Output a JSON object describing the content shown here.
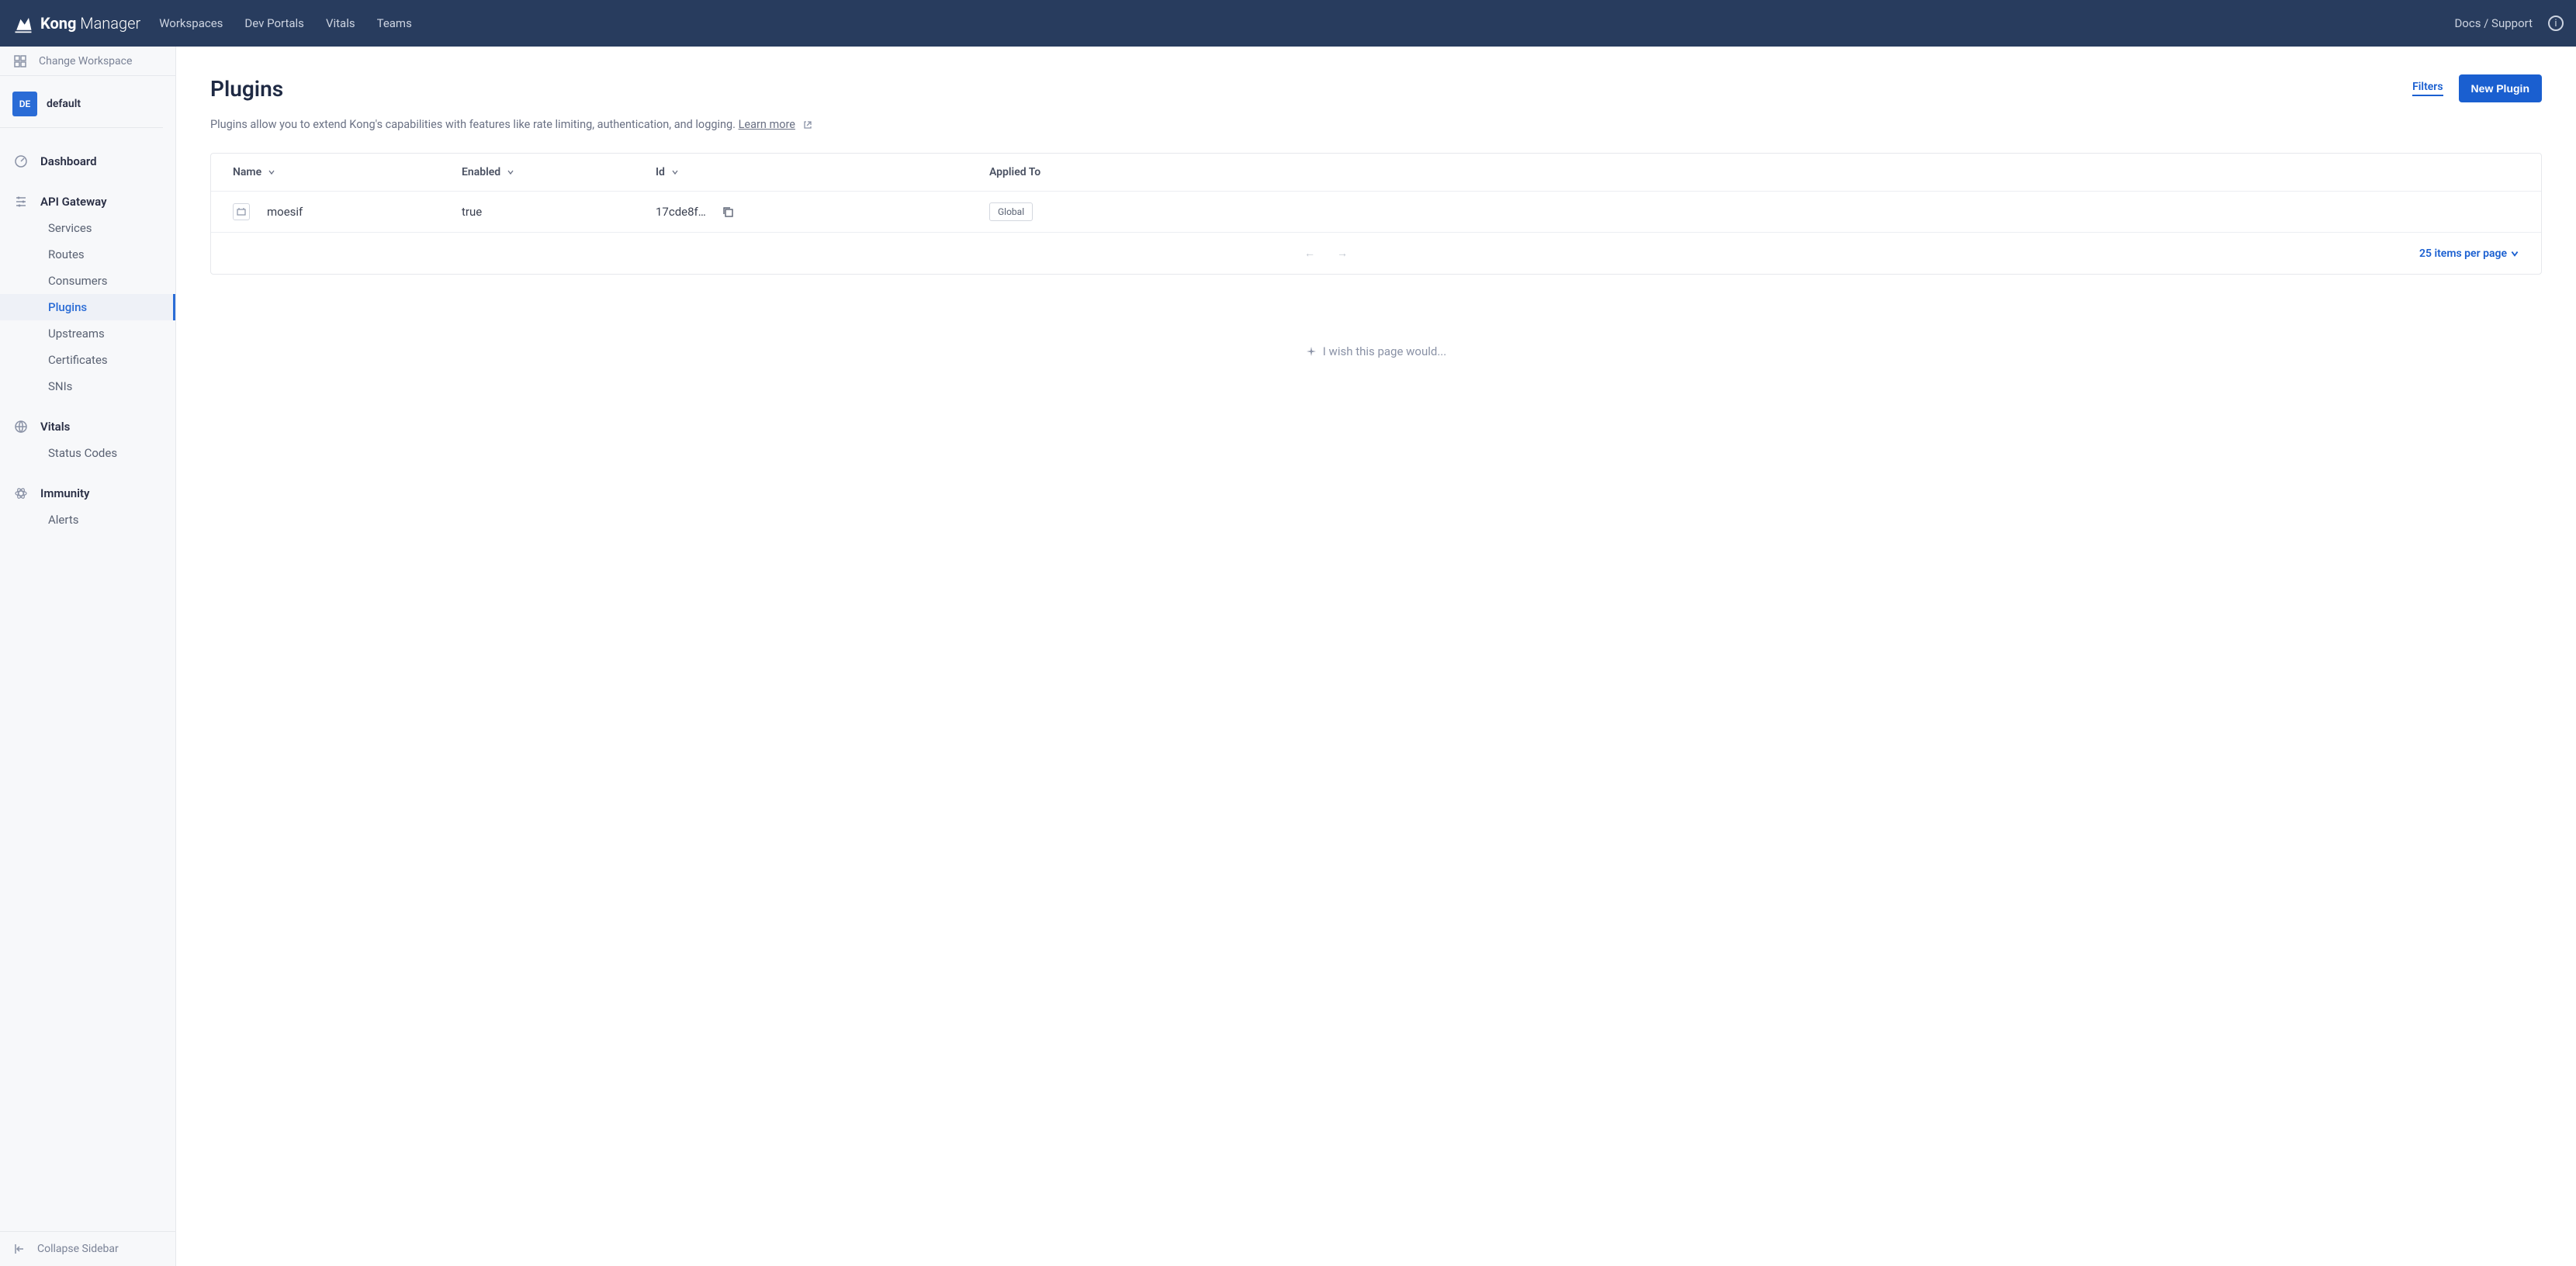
{
  "brand": {
    "name_bold": "Kong",
    "name_light": " Manager"
  },
  "topnav": [
    "Workspaces",
    "Dev Portals",
    "Vitals",
    "Teams"
  ],
  "top_right": {
    "docs": "Docs / Support"
  },
  "sidebar": {
    "change_workspace": "Change Workspace",
    "workspace_badge": "DE",
    "workspace_name": "default",
    "dashboard": "Dashboard",
    "api_gateway": {
      "label": "API Gateway",
      "items": [
        "Services",
        "Routes",
        "Consumers",
        "Plugins",
        "Upstreams",
        "Certificates",
        "SNIs"
      ],
      "active_index": 3
    },
    "vitals": {
      "label": "Vitals",
      "items": [
        "Status Codes"
      ]
    },
    "immunity": {
      "label": "Immunity",
      "items": [
        "Alerts"
      ]
    },
    "collapse": "Collapse Sidebar"
  },
  "page": {
    "title": "Plugins",
    "filters": "Filters",
    "new_button": "New Plugin",
    "description": "Plugins allow you to extend Kong's capabilities with features like rate limiting, authentication, and logging. ",
    "learn_more": "Learn more"
  },
  "table": {
    "columns": [
      "Name",
      "Enabled",
      "Id",
      "Applied To"
    ],
    "rows": [
      {
        "name": "moesif",
        "enabled": "true",
        "id": "17cde8f…",
        "applied_to": "Global"
      }
    ],
    "per_page": "25 items per page"
  },
  "wish": "I wish this page would..."
}
